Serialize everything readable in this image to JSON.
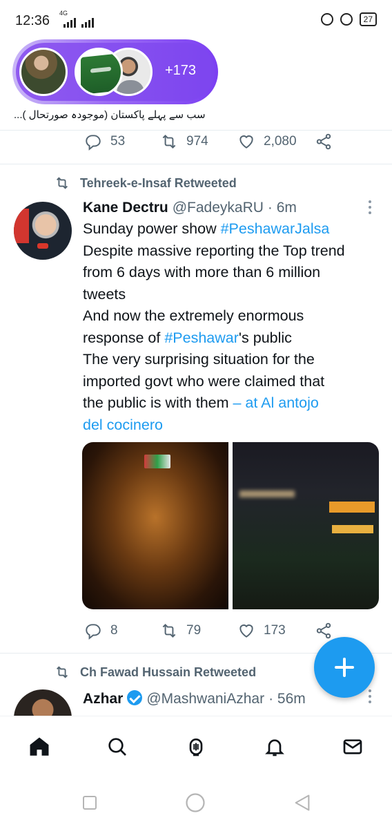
{
  "status_bar": {
    "time": "12:36",
    "network": "4G",
    "battery": "27"
  },
  "spaces": {
    "listener_count": "+173",
    "caption": "سب سے پہلے پاکستان (موجودہ صورتحال )..."
  },
  "prev_tweet_actions": {
    "replies": "53",
    "retweets": "974",
    "likes": "2,080"
  },
  "tweet": {
    "retweeted_by": "Tehreek-e-Insaf Retweeted",
    "name": "Kane Dectru",
    "handle": "@FadeykaRU",
    "time": "· 6m",
    "lines": [
      {
        "pre": "Sunday power show ",
        "link": "#PeshawarJalsa",
        "post": ""
      },
      {
        "pre": "Despite massive reporting the Top trend",
        "link": "",
        "post": ""
      },
      {
        "pre": "from 6 days with more than 6 million",
        "link": "",
        "post": ""
      },
      {
        "pre": "tweets",
        "link": "",
        "post": ""
      },
      {
        "pre": "And now the extremely enormous",
        "link": "",
        "post": ""
      },
      {
        "pre": "response of ",
        "link": "#Peshawar",
        "post": "'s public"
      },
      {
        "pre": "The very surprising situation for the",
        "link": "",
        "post": ""
      },
      {
        "pre": "imported govt who were claimed that",
        "link": "",
        "post": ""
      },
      {
        "pre": "the  public is with them ",
        "link": "– at Al antojo",
        "post": ""
      },
      {
        "pre": "",
        "link": "del cocinero",
        "post": ""
      }
    ],
    "replies": "8",
    "retweets": "79",
    "likes": "173"
  },
  "next_tweet": {
    "retweeted_by": "Ch Fawad Hussain Retweeted",
    "name": "Azhar",
    "handle": "@MashwaniAzhar",
    "time": "· 56m"
  },
  "colors": {
    "accent": "#1d9bf0",
    "muted": "#536471",
    "spaces_purple": "#7d45ef"
  },
  "nav": [
    "home-icon",
    "search-icon",
    "spaces-icon",
    "notifications-icon",
    "messages-icon"
  ]
}
